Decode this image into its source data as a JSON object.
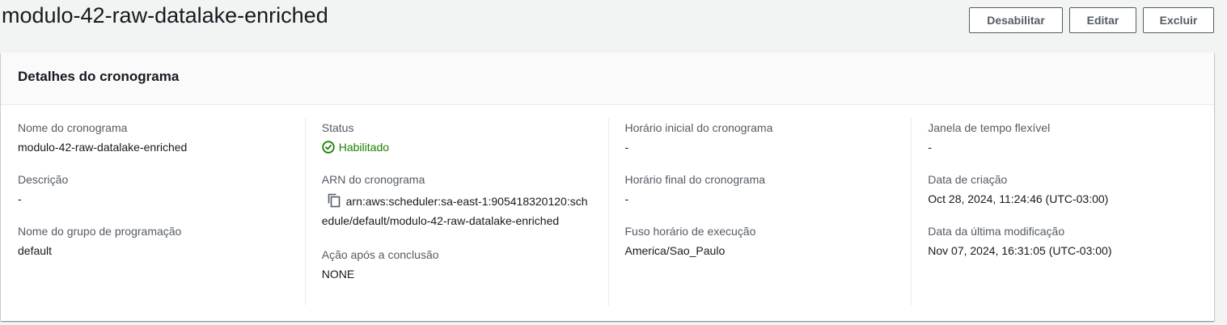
{
  "page": {
    "title": "modulo-42-raw-datalake-enriched"
  },
  "actions": {
    "disable_label": "Desabilitar",
    "edit_label": "Editar",
    "delete_label": "Excluir"
  },
  "panel": {
    "title": "Detalhes do cronograma",
    "columns": [
      [
        {
          "label": "Nome do cronograma",
          "value": "modulo-42-raw-datalake-enriched"
        },
        {
          "label": "Descrição",
          "value": "-"
        },
        {
          "label": "Nome do grupo de programação",
          "value": "default"
        }
      ],
      [
        {
          "label": "Status",
          "value": "Habilitado"
        },
        {
          "label": "ARN do cronograma",
          "value": "arn:aws:scheduler:sa-east-1:905418320120:schedule/default/modulo-42-raw-datalake-enriched"
        },
        {
          "label": "Ação após a conclusão",
          "value": "NONE"
        }
      ],
      [
        {
          "label": "Horário inicial do cronograma",
          "value": "-"
        },
        {
          "label": "Horário final do cronograma",
          "value": "-"
        },
        {
          "label": "Fuso horário de execução",
          "value": "America/Sao_Paulo"
        }
      ],
      [
        {
          "label": "Janela de tempo flexível",
          "value": "-"
        },
        {
          "label": "Data de criação",
          "value": "Oct 28, 2024, 11:24:46 (UTC-03:00)"
        },
        {
          "label": "Data da última modificação",
          "value": "Nov 07, 2024, 16:31:05 (UTC-03:00)"
        }
      ]
    ]
  },
  "colors": {
    "status_ok": "#1d8102",
    "label": "#545b64",
    "text": "#16191f"
  },
  "icons": {
    "status": "check-circle-icon",
    "copy": "copy-icon"
  }
}
